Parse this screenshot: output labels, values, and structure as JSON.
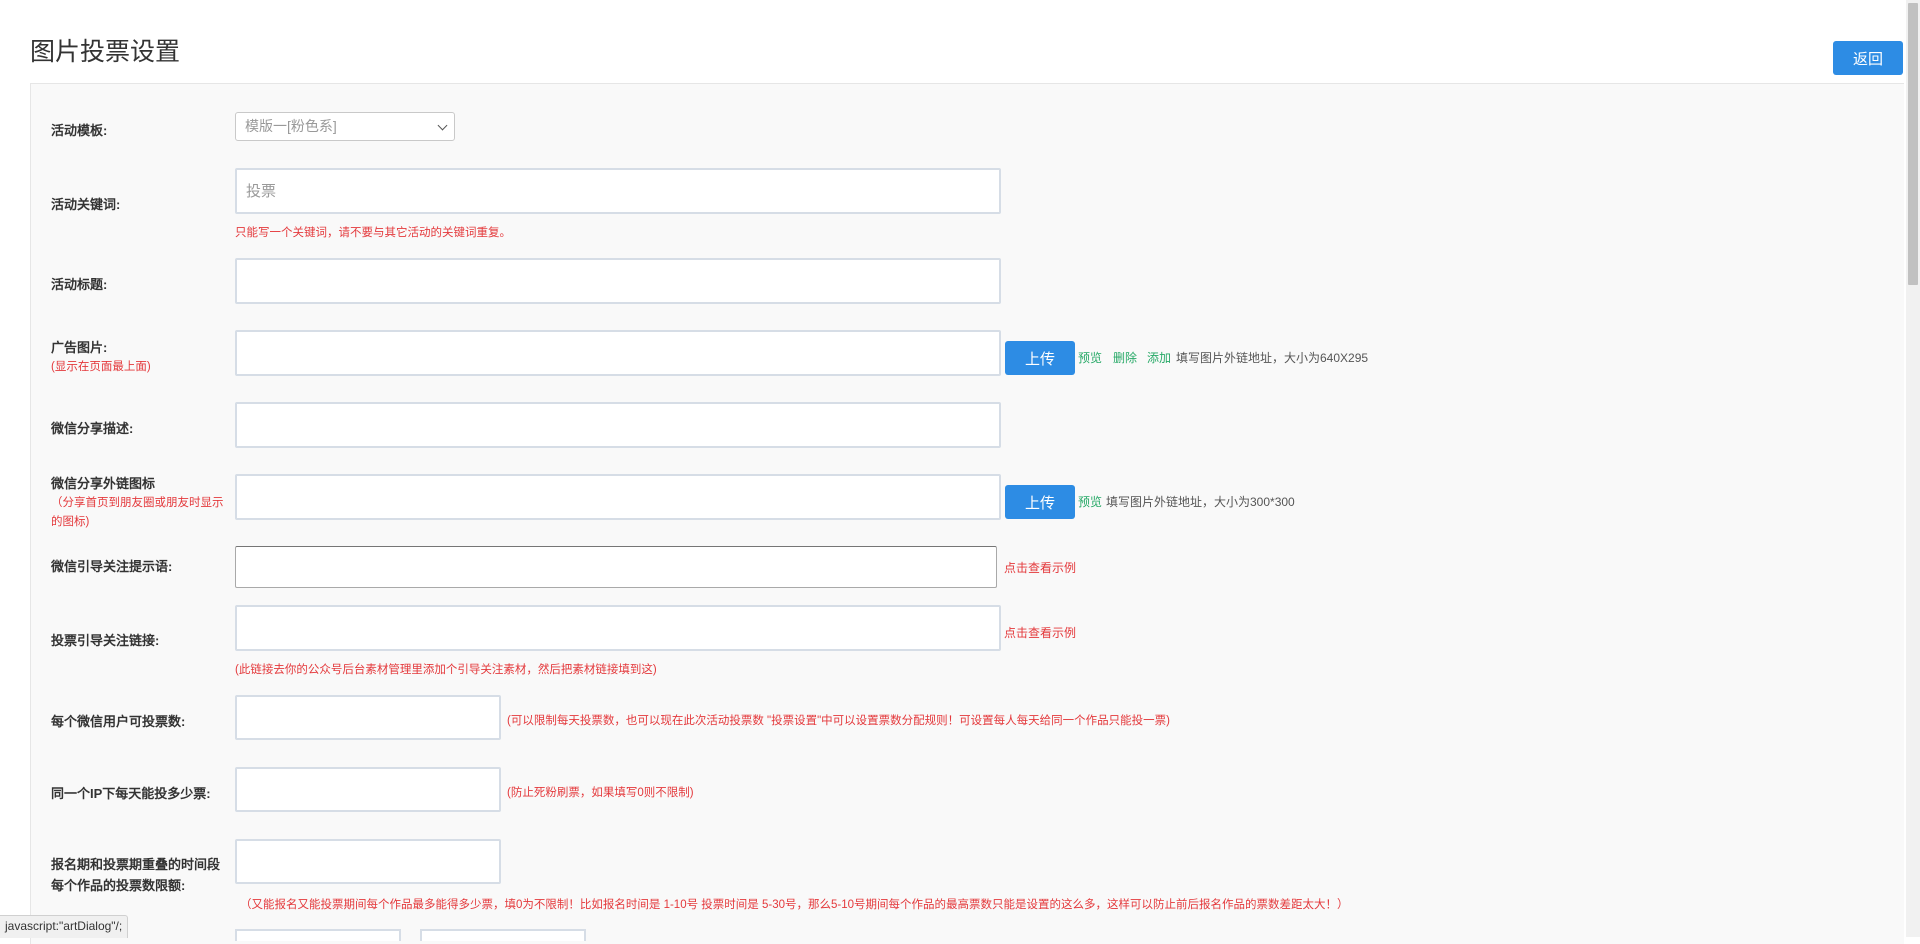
{
  "header": {
    "title": "图片投票设置",
    "back_label": "返回"
  },
  "form": {
    "template": {
      "label": "活动模板:",
      "selected": "模版一[粉色系]"
    },
    "keyword": {
      "label": "活动关键词:",
      "value": "投票",
      "hint": "只能写一个关键词，请不要与其它活动的关键词重复。"
    },
    "title": {
      "label": "活动标题:",
      "value": ""
    },
    "ad_image": {
      "label": "广告图片:",
      "sub": "(显示在页面最上面)",
      "value": "",
      "upload_label": "上传",
      "preview_label": "预览",
      "delete_label": "删除",
      "add_label": "添加",
      "note": "填写图片外链地址，大小为640X295"
    },
    "share_desc": {
      "label": "微信分享描述:",
      "value": ""
    },
    "share_icon": {
      "label": "微信分享外链图标",
      "sub_line1": "（分享首页到朋友圈或朋友时显示",
      "sub_line2": "的图标)",
      "value": "",
      "upload_label": "上传",
      "preview_label": "预览",
      "note": "填写图片外链地址，大小为300*300"
    },
    "follow_tip": {
      "label": "微信引导关注提示语:",
      "value": "",
      "example_label": "点击查看示例"
    },
    "follow_link": {
      "label": "投票引导关注链接:",
      "value": "",
      "example_label": "点击查看示例",
      "hint": "(此链接去你的公众号后台素材管理里添加个引导关注素材，然后把素材链接填到这)"
    },
    "votes_per_user": {
      "label": "每个微信用户可投票数:",
      "value": "",
      "hint": "(可以限制每天投票数，也可以现在此次活动投票数 \"投票设置\"中可以设置票数分配规则！可设置每人每天给同一个作品只能投一票)"
    },
    "votes_per_ip": {
      "label": "同一个IP下每天能投多少票:",
      "value": "",
      "hint": "(防止死粉刷票，如果填写0则不限制)"
    },
    "overlap_limit": {
      "label_line1": "报名期和投票期重叠的时间段",
      "label_line2": "每个作品的投票数限额:",
      "value": "",
      "hint": "（又能报名又能投票期间每个作品最多能得多少票，填0为不限制！比如报名时间是 1-10号 投票时间是 5-30号，那么5-10号期间每个作品的最高票数只能是设置的这么多，这样可以防止前后报名作品的票数差距太大！）"
    }
  },
  "status_bar": {
    "text": "javascript:\"artDialog\"/;"
  }
}
